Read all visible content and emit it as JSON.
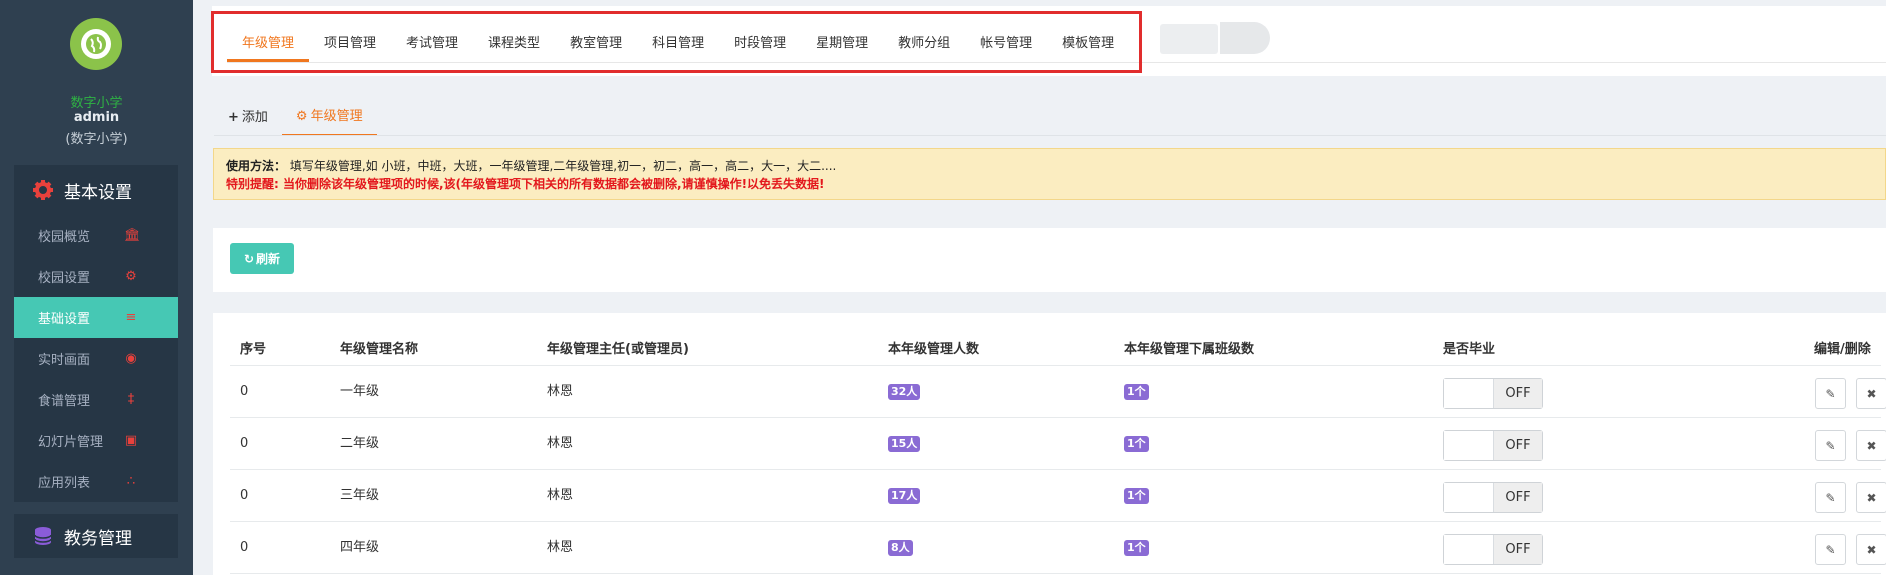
{
  "sidebar": {
    "school_name": "数字小学",
    "username": "admin",
    "school_sub": "(数字小学)",
    "group1_title": "基本设置",
    "items": [
      {
        "label": "校园概览",
        "icon": "bank-icon"
      },
      {
        "label": "校园设置",
        "icon": "gear-icon"
      },
      {
        "label": "基础设置",
        "icon": "list-icon",
        "active": true
      },
      {
        "label": "实时画面",
        "icon": "eye-icon"
      },
      {
        "label": "食谱管理",
        "icon": "cutlery-icon"
      },
      {
        "label": "幻灯片管理",
        "icon": "picture-icon"
      },
      {
        "label": "应用列表",
        "icon": "cubes-icon"
      }
    ],
    "group2_title": "教务管理"
  },
  "top_tabs": [
    "年级管理",
    "项目管理",
    "考试管理",
    "课程类型",
    "教室管理",
    "科目管理",
    "时段管理",
    "星期管理",
    "教师分组",
    "帐号管理",
    "模板管理"
  ],
  "sub_tabs": {
    "add": "添加",
    "grade": "年级管理"
  },
  "notice": {
    "usage_label": "使用方法：",
    "usage_text": "填写年级管理,如 小班，中班，大班，一年级管理,二年级管理,初一，初二，高一，高二，大一，大二....",
    "warning": "特别提醒: 当你删除该年级管理项的时候,该(年级管理项下相关的所有数据都会被删除,请谨慎操作!以免丢失数据!"
  },
  "refresh_label": "刷新",
  "table": {
    "headers": [
      "序号",
      "年级管理名称",
      "年级管理主任(或管理员)",
      "本年级管理人数",
      "本年级管理下属班级数",
      "是否毕业",
      "编辑/删除"
    ],
    "rows": [
      {
        "no": "0",
        "name": "一年级",
        "head": "林恩",
        "count": "32人",
        "classes": "1个",
        "graduated": "OFF"
      },
      {
        "no": "0",
        "name": "二年级",
        "head": "林恩",
        "count": "15人",
        "classes": "1个",
        "graduated": "OFF"
      },
      {
        "no": "0",
        "name": "三年级",
        "head": "林恩",
        "count": "17人",
        "classes": "1个",
        "graduated": "OFF"
      },
      {
        "no": "0",
        "name": "四年级",
        "head": "林恩",
        "count": "8人",
        "classes": "1个",
        "graduated": "OFF"
      }
    ]
  },
  "colors": {
    "sidebar": "#2f4050",
    "accent": "#46c8b4",
    "tab_active": "#f0771f",
    "badge": "#8a6bd4",
    "highlight_box": "#e12d2d"
  }
}
